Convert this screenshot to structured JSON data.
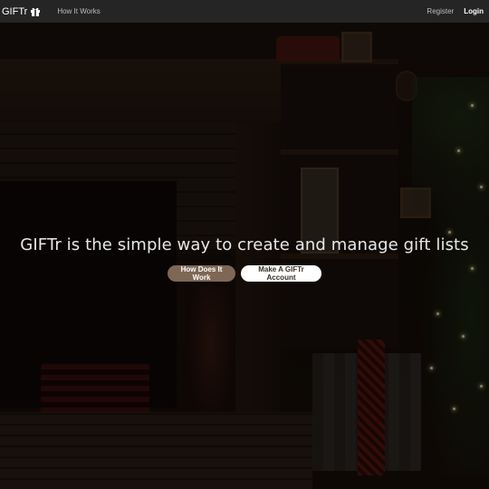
{
  "navbar": {
    "brand": "GIFTr",
    "brand_icon": "gift-icon",
    "links": [
      {
        "label": "How It Works"
      }
    ],
    "right_links": {
      "register": "Register",
      "login": "Login"
    }
  },
  "hero": {
    "headline": "GIFTr is the simple way to create and manage gift lists",
    "buttons": {
      "how": "How Does It Work",
      "create": "Make A GIFTr Account"
    }
  },
  "colors": {
    "navbar_bg": "#252525",
    "button_primary": "#7e6754",
    "button_secondary": "#ffffff"
  }
}
